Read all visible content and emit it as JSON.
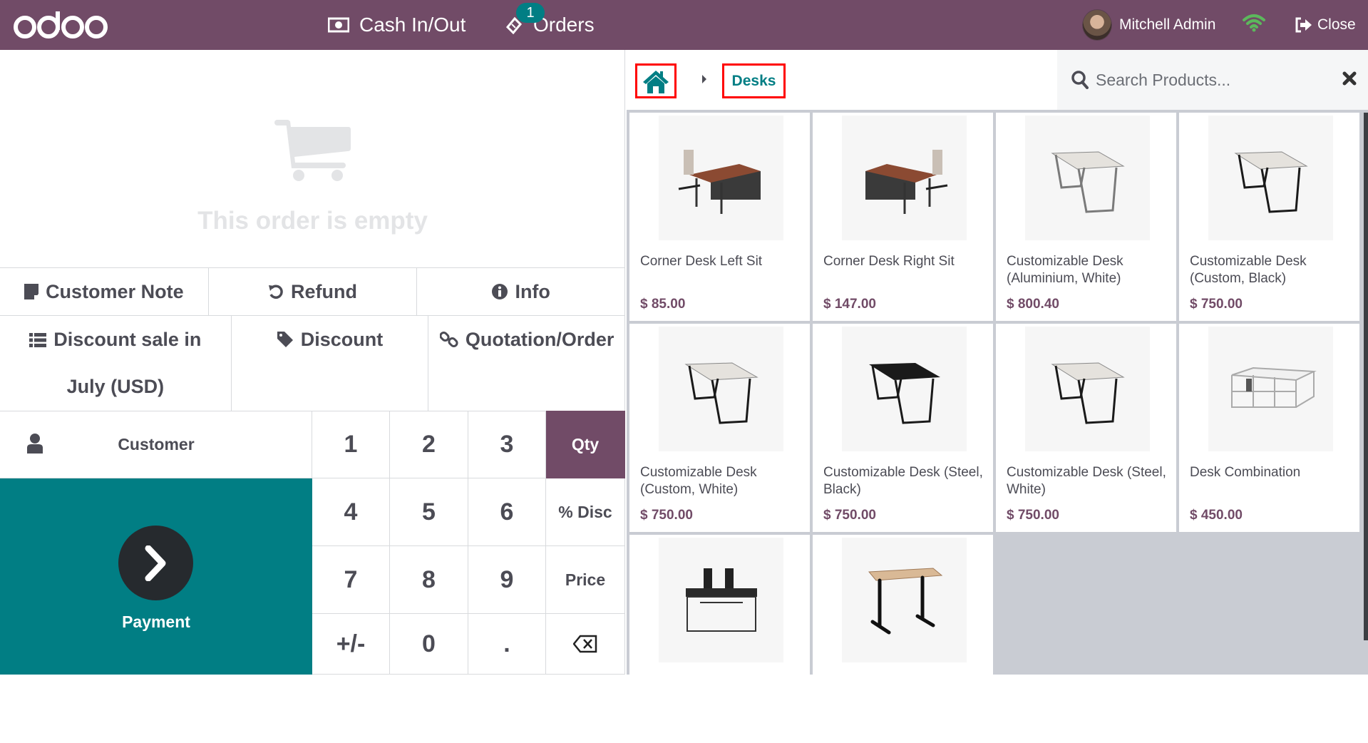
{
  "header": {
    "logo": "odoo",
    "cash_in_out": "Cash In/Out",
    "orders": "Orders",
    "orders_badge": "1",
    "user_name": "Mitchell Admin",
    "close": "Close"
  },
  "colors": {
    "brand": "#714b67",
    "accent": "#017e84",
    "wifi": "#5cb85c",
    "highlight_border": "#ff0000"
  },
  "order": {
    "empty_text": "This order is empty"
  },
  "controls": {
    "customer_note": "Customer Note",
    "refund": "Refund",
    "info": "Info",
    "discount_sale": "Discount sale in July (USD)",
    "discount": "Discount",
    "quotation_order": "Quotation/Order"
  },
  "numpad": {
    "customer": "Customer",
    "payment": "Payment",
    "keys": [
      "1",
      "2",
      "3",
      "Qty",
      "4",
      "5",
      "6",
      "% Disc",
      "7",
      "8",
      "9",
      "Price",
      "+/-",
      "0",
      "."
    ],
    "active_mode": "Qty"
  },
  "breadcrumb": {
    "current": "Desks"
  },
  "search": {
    "placeholder": "Search Products...",
    "value": ""
  },
  "products": [
    {
      "name": "Corner Desk Left Sit",
      "price": "$ 85.00",
      "image": "corner-desk-left"
    },
    {
      "name": "Corner Desk Right Sit",
      "price": "$ 147.00",
      "image": "corner-desk-right"
    },
    {
      "name": "Customizable Desk (Aluminium, White)",
      "price": "$ 800.40",
      "image": "desk-alu-white"
    },
    {
      "name": "Customizable Desk (Custom, Black)",
      "price": "$ 750.00",
      "image": "desk-white-black"
    },
    {
      "name": "Customizable Desk (Custom, White)",
      "price": "$ 750.00",
      "image": "desk-white-black"
    },
    {
      "name": "Customizable Desk (Steel, Black)",
      "price": "$ 750.00",
      "image": "desk-black"
    },
    {
      "name": "Customizable Desk (Steel, White)",
      "price": "$ 750.00",
      "image": "desk-white-black"
    },
    {
      "name": "Desk Combination",
      "price": "$ 450.00",
      "image": "desk-combination"
    },
    {
      "name": "",
      "price": "",
      "image": "desk-dual-monitor"
    },
    {
      "name": "",
      "price": "",
      "image": "standing-desk"
    }
  ]
}
